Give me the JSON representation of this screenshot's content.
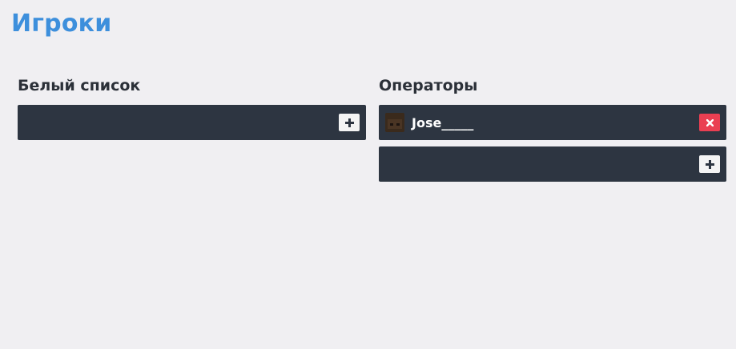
{
  "page": {
    "title": "Игроки"
  },
  "whitelist": {
    "title": "Белый список",
    "entries": [],
    "add_icon": "plus-icon"
  },
  "operators": {
    "title": "Операторы",
    "entries": [
      {
        "name": "Jose_____",
        "avatar": "player-head-avatar"
      }
    ],
    "add_icon": "plus-icon",
    "remove_icon": "close-icon"
  },
  "colors": {
    "accent": "#3d8fdc",
    "row_bg": "#2d3541",
    "remove": "#ea3f52",
    "page_bg": "#f0eff2"
  }
}
